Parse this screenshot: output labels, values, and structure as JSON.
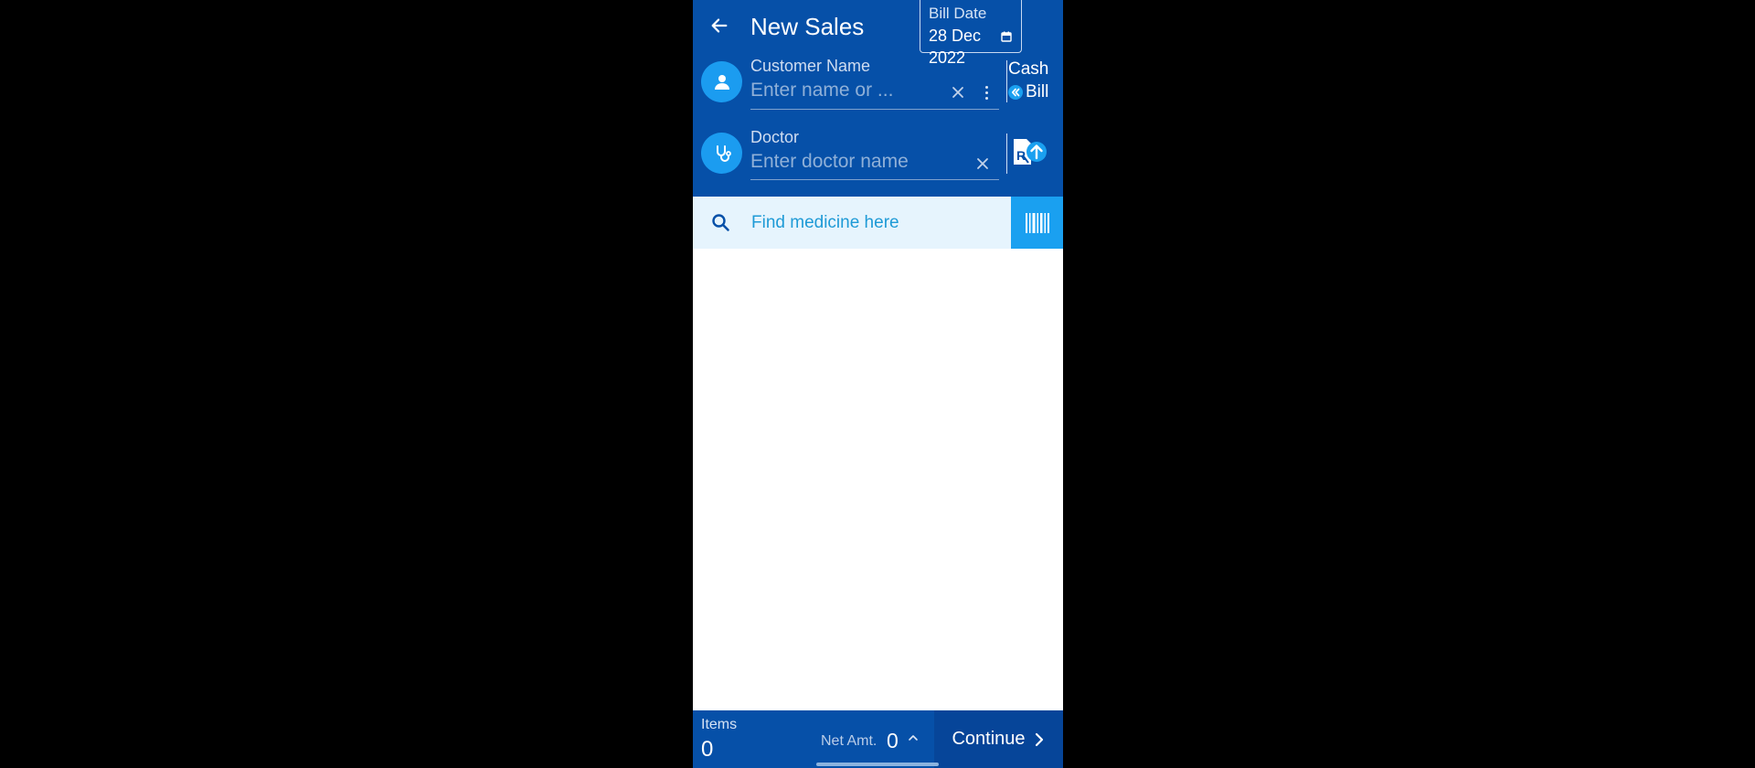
{
  "header": {
    "title": "New Sales",
    "back_icon": "arrow-left-icon",
    "bill_date": {
      "label": "Bill Date",
      "value": "28 Dec 2022",
      "icon": "calendar-icon"
    }
  },
  "customer": {
    "label": "Customer Name",
    "placeholder": "Enter name or ...",
    "icon": "person-icon",
    "payment": {
      "cash": "Cash",
      "bill": "Bill"
    }
  },
  "doctor": {
    "label": "Doctor",
    "placeholder": "Enter doctor name",
    "icon": "stethoscope-icon",
    "upload_icon": "rx-upload-icon"
  },
  "search": {
    "placeholder": "Find medicine here",
    "barcode_icon": "barcode-icon"
  },
  "footer": {
    "items_label": "Items",
    "items_value": "0",
    "net_label": "Net Amt.",
    "net_value": "0",
    "continue_label": "Continue"
  },
  "colors": {
    "primary": "#0650a8",
    "accent": "#1aa0f0",
    "search_bg": "#e6f4fd",
    "frame": "#000000"
  }
}
